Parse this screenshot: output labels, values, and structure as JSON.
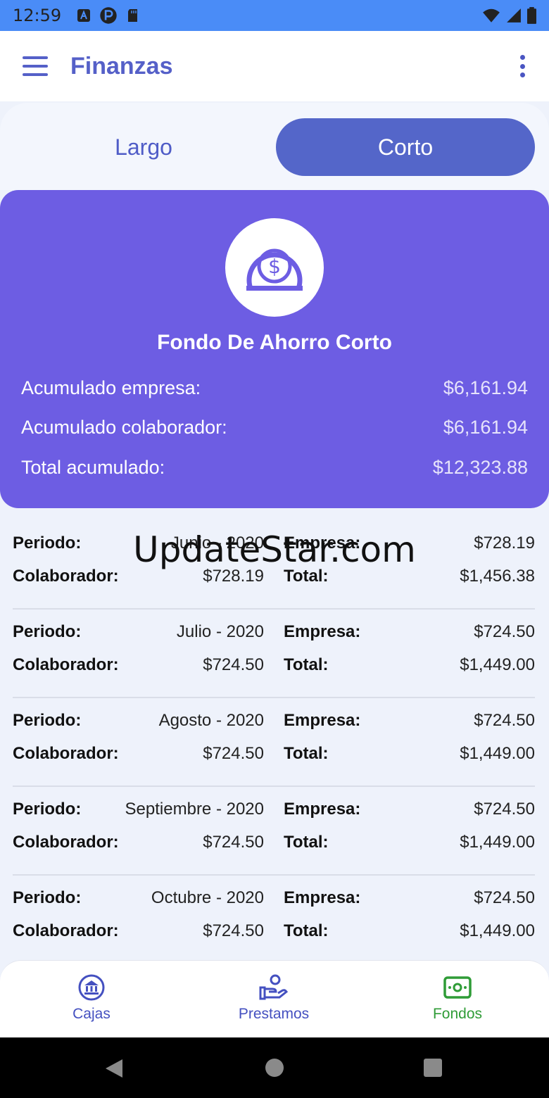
{
  "status_bar": {
    "time": "12:59",
    "left_icons": [
      "a-icon",
      "p-icon",
      "sd-card-icon"
    ],
    "right_icons": [
      "wifi-icon",
      "signal-icon",
      "battery-icon"
    ]
  },
  "app_bar": {
    "title": "Finanzas"
  },
  "tabs": [
    {
      "label": "Largo",
      "active": false
    },
    {
      "label": "Corto",
      "active": true
    }
  ],
  "summary": {
    "icon": "coin-icon",
    "title": "Fondo De Ahorro Corto",
    "rows": [
      {
        "label": "Acumulado empresa:",
        "value": "$6,161.94"
      },
      {
        "label": "Acumulado colaborador:",
        "value": "$6,161.94"
      },
      {
        "label": "Total acumulado:",
        "value": "$12,323.88"
      }
    ]
  },
  "labels": {
    "periodo": "Periodo:",
    "empresa": "Empresa:",
    "colaborador": "Colaborador:",
    "total": "Total:"
  },
  "records": [
    {
      "periodo": "Junio - 2020",
      "empresa": "$728.19",
      "colaborador": "$728.19",
      "total": "$1,456.38"
    },
    {
      "periodo": "Julio - 2020",
      "empresa": "$724.50",
      "colaborador": "$724.50",
      "total": "$1,449.00"
    },
    {
      "periodo": "Agosto - 2020",
      "empresa": "$724.50",
      "colaborador": "$724.50",
      "total": "$1,449.00"
    },
    {
      "periodo": "Septiembre - 2020",
      "empresa": "$724.50",
      "colaborador": "$724.50",
      "total": "$1,449.00"
    },
    {
      "periodo": "Octubre - 2020",
      "empresa": "$724.50",
      "colaborador": "$724.50",
      "total": "$1,449.00"
    }
  ],
  "watermark": "UpdateStar.com",
  "bottom_nav": [
    {
      "label": "Cajas",
      "icon": "bank-icon",
      "active": false,
      "color": "#4450c0"
    },
    {
      "label": "Prestamos",
      "icon": "hand-coin-icon",
      "active": false,
      "color": "#4450c0"
    },
    {
      "label": "Fondos",
      "icon": "cash-icon",
      "active": true,
      "color": "#2f9c37"
    }
  ],
  "colors": {
    "status_bar": "#4a8cf7",
    "accent": "#5560c8",
    "card": "#6d5de3",
    "active_tab": "#5466c9",
    "active_nav": "#2f9c37"
  }
}
